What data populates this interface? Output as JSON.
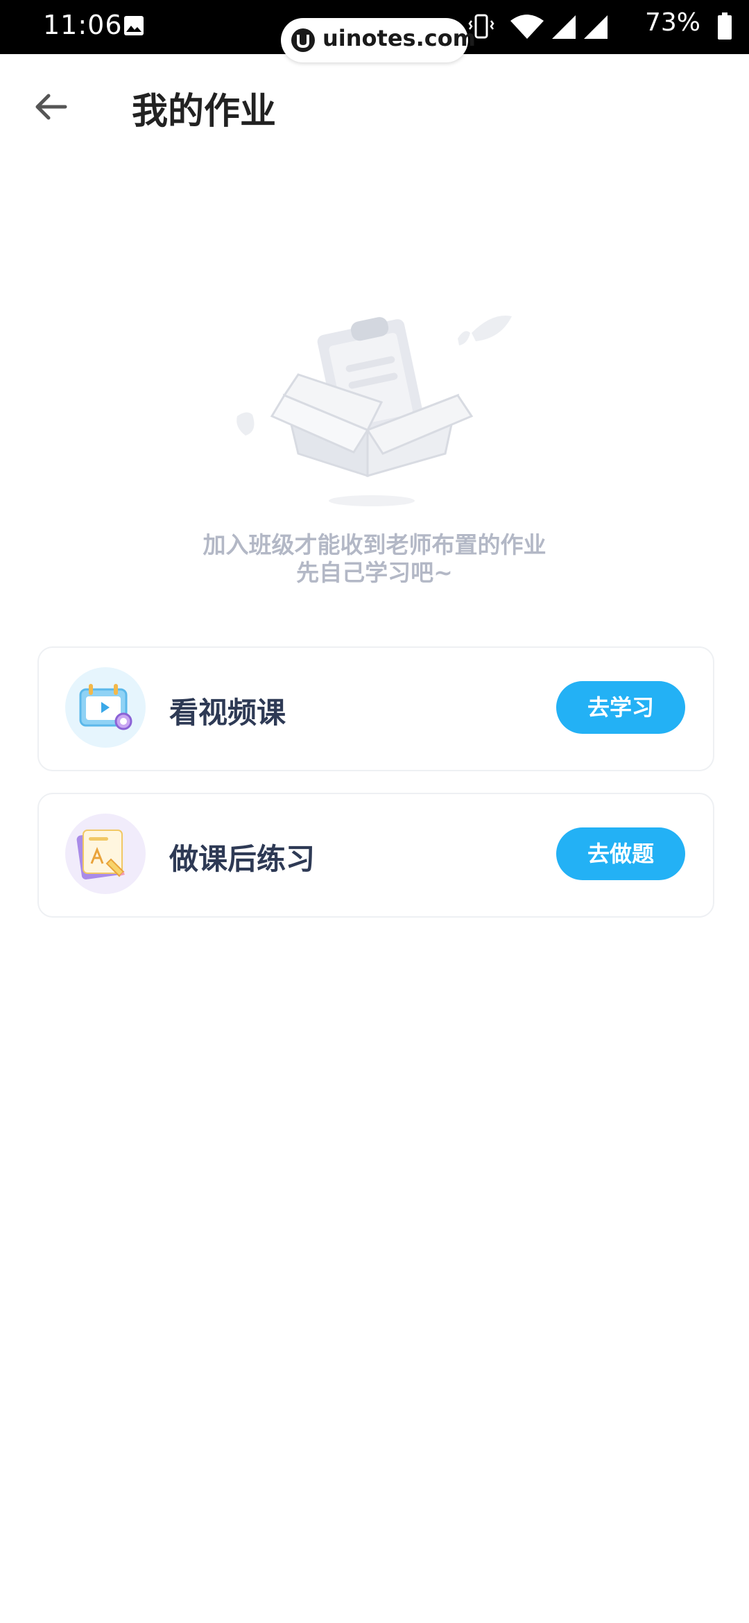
{
  "status_bar": {
    "time": "11:06",
    "battery": "73%",
    "watermark": "uinotes.com"
  },
  "header": {
    "title": "我的作业"
  },
  "empty_state": {
    "line1": "加入班级才能收到老师布置的作业",
    "line2": "先自己学习吧~"
  },
  "cards": [
    {
      "label": "看视频课",
      "button": "去学习",
      "icon": "video-lesson-icon"
    },
    {
      "label": "做课后练习",
      "button": "去做题",
      "icon": "exercise-icon"
    }
  ],
  "colors": {
    "accent": "#23b1f5",
    "title": "#222222",
    "label": "#2e3a55",
    "hint": "#b3b8c6"
  }
}
